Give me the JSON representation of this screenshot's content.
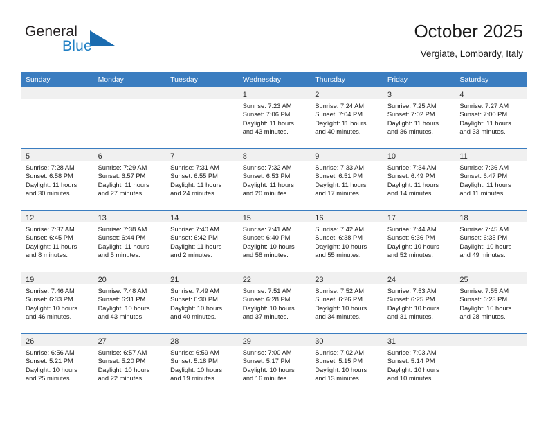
{
  "brand": {
    "name_top": "General",
    "name_bottom": "Blue",
    "triangle_icon": "blue-triangle-logo-mark",
    "color_dark": "#231f20",
    "color_blue": "#1f7fc4"
  },
  "header": {
    "title": "October 2025",
    "subtitle": "Vergiate, Lombardy, Italy"
  },
  "theme": {
    "header_bg": "#3b7dc0",
    "header_text": "#ffffff",
    "daynum_strip_bg": "#f0f0f0",
    "row_divider": "#3b7dc0",
    "body_text": "#1a1a1a"
  },
  "weekday_headers": [
    "Sunday",
    "Monday",
    "Tuesday",
    "Wednesday",
    "Thursday",
    "Friday",
    "Saturday"
  ],
  "weeks": [
    [
      {
        "day": "",
        "lines": []
      },
      {
        "day": "",
        "lines": []
      },
      {
        "day": "",
        "lines": []
      },
      {
        "day": "1",
        "lines": [
          "Sunrise: 7:23 AM",
          "Sunset: 7:06 PM",
          "Daylight: 11 hours",
          "and 43 minutes."
        ]
      },
      {
        "day": "2",
        "lines": [
          "Sunrise: 7:24 AM",
          "Sunset: 7:04 PM",
          "Daylight: 11 hours",
          "and 40 minutes."
        ]
      },
      {
        "day": "3",
        "lines": [
          "Sunrise: 7:25 AM",
          "Sunset: 7:02 PM",
          "Daylight: 11 hours",
          "and 36 minutes."
        ]
      },
      {
        "day": "4",
        "lines": [
          "Sunrise: 7:27 AM",
          "Sunset: 7:00 PM",
          "Daylight: 11 hours",
          "and 33 minutes."
        ]
      }
    ],
    [
      {
        "day": "5",
        "lines": [
          "Sunrise: 7:28 AM",
          "Sunset: 6:58 PM",
          "Daylight: 11 hours",
          "and 30 minutes."
        ]
      },
      {
        "day": "6",
        "lines": [
          "Sunrise: 7:29 AM",
          "Sunset: 6:57 PM",
          "Daylight: 11 hours",
          "and 27 minutes."
        ]
      },
      {
        "day": "7",
        "lines": [
          "Sunrise: 7:31 AM",
          "Sunset: 6:55 PM",
          "Daylight: 11 hours",
          "and 24 minutes."
        ]
      },
      {
        "day": "8",
        "lines": [
          "Sunrise: 7:32 AM",
          "Sunset: 6:53 PM",
          "Daylight: 11 hours",
          "and 20 minutes."
        ]
      },
      {
        "day": "9",
        "lines": [
          "Sunrise: 7:33 AM",
          "Sunset: 6:51 PM",
          "Daylight: 11 hours",
          "and 17 minutes."
        ]
      },
      {
        "day": "10",
        "lines": [
          "Sunrise: 7:34 AM",
          "Sunset: 6:49 PM",
          "Daylight: 11 hours",
          "and 14 minutes."
        ]
      },
      {
        "day": "11",
        "lines": [
          "Sunrise: 7:36 AM",
          "Sunset: 6:47 PM",
          "Daylight: 11 hours",
          "and 11 minutes."
        ]
      }
    ],
    [
      {
        "day": "12",
        "lines": [
          "Sunrise: 7:37 AM",
          "Sunset: 6:45 PM",
          "Daylight: 11 hours",
          "and 8 minutes."
        ]
      },
      {
        "day": "13",
        "lines": [
          "Sunrise: 7:38 AM",
          "Sunset: 6:44 PM",
          "Daylight: 11 hours",
          "and 5 minutes."
        ]
      },
      {
        "day": "14",
        "lines": [
          "Sunrise: 7:40 AM",
          "Sunset: 6:42 PM",
          "Daylight: 11 hours",
          "and 2 minutes."
        ]
      },
      {
        "day": "15",
        "lines": [
          "Sunrise: 7:41 AM",
          "Sunset: 6:40 PM",
          "Daylight: 10 hours",
          "and 58 minutes."
        ]
      },
      {
        "day": "16",
        "lines": [
          "Sunrise: 7:42 AM",
          "Sunset: 6:38 PM",
          "Daylight: 10 hours",
          "and 55 minutes."
        ]
      },
      {
        "day": "17",
        "lines": [
          "Sunrise: 7:44 AM",
          "Sunset: 6:36 PM",
          "Daylight: 10 hours",
          "and 52 minutes."
        ]
      },
      {
        "day": "18",
        "lines": [
          "Sunrise: 7:45 AM",
          "Sunset: 6:35 PM",
          "Daylight: 10 hours",
          "and 49 minutes."
        ]
      }
    ],
    [
      {
        "day": "19",
        "lines": [
          "Sunrise: 7:46 AM",
          "Sunset: 6:33 PM",
          "Daylight: 10 hours",
          "and 46 minutes."
        ]
      },
      {
        "day": "20",
        "lines": [
          "Sunrise: 7:48 AM",
          "Sunset: 6:31 PM",
          "Daylight: 10 hours",
          "and 43 minutes."
        ]
      },
      {
        "day": "21",
        "lines": [
          "Sunrise: 7:49 AM",
          "Sunset: 6:30 PM",
          "Daylight: 10 hours",
          "and 40 minutes."
        ]
      },
      {
        "day": "22",
        "lines": [
          "Sunrise: 7:51 AM",
          "Sunset: 6:28 PM",
          "Daylight: 10 hours",
          "and 37 minutes."
        ]
      },
      {
        "day": "23",
        "lines": [
          "Sunrise: 7:52 AM",
          "Sunset: 6:26 PM",
          "Daylight: 10 hours",
          "and 34 minutes."
        ]
      },
      {
        "day": "24",
        "lines": [
          "Sunrise: 7:53 AM",
          "Sunset: 6:25 PM",
          "Daylight: 10 hours",
          "and 31 minutes."
        ]
      },
      {
        "day": "25",
        "lines": [
          "Sunrise: 7:55 AM",
          "Sunset: 6:23 PM",
          "Daylight: 10 hours",
          "and 28 minutes."
        ]
      }
    ],
    [
      {
        "day": "26",
        "lines": [
          "Sunrise: 6:56 AM",
          "Sunset: 5:21 PM",
          "Daylight: 10 hours",
          "and 25 minutes."
        ]
      },
      {
        "day": "27",
        "lines": [
          "Sunrise: 6:57 AM",
          "Sunset: 5:20 PM",
          "Daylight: 10 hours",
          "and 22 minutes."
        ]
      },
      {
        "day": "28",
        "lines": [
          "Sunrise: 6:59 AM",
          "Sunset: 5:18 PM",
          "Daylight: 10 hours",
          "and 19 minutes."
        ]
      },
      {
        "day": "29",
        "lines": [
          "Sunrise: 7:00 AM",
          "Sunset: 5:17 PM",
          "Daylight: 10 hours",
          "and 16 minutes."
        ]
      },
      {
        "day": "30",
        "lines": [
          "Sunrise: 7:02 AM",
          "Sunset: 5:15 PM",
          "Daylight: 10 hours",
          "and 13 minutes."
        ]
      },
      {
        "day": "31",
        "lines": [
          "Sunrise: 7:03 AM",
          "Sunset: 5:14 PM",
          "Daylight: 10 hours",
          "and 10 minutes."
        ]
      },
      {
        "day": "",
        "lines": []
      }
    ]
  ]
}
